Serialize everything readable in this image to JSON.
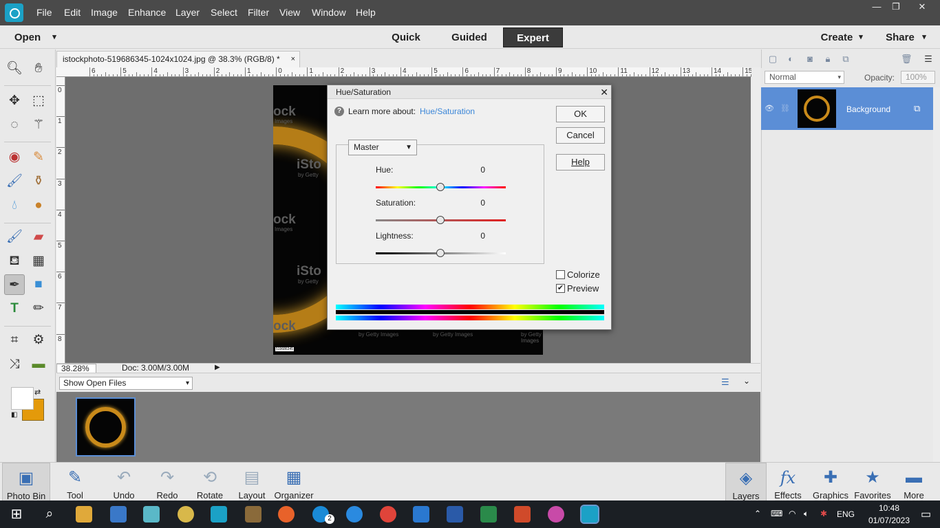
{
  "menubar": {
    "items": [
      "File",
      "Edit",
      "Image",
      "Enhance",
      "Layer",
      "Select",
      "Filter",
      "View",
      "Window",
      "Help"
    ],
    "win_min": "—",
    "win_max": "❐",
    "win_close": "✕"
  },
  "modebar": {
    "open_label": "Open",
    "open_arrow": "▾",
    "modes": [
      "Quick",
      "Guided",
      "Expert"
    ],
    "active_mode": "Expert",
    "create_label": "Create",
    "share_label": "Share",
    "arrow": "▾"
  },
  "document": {
    "tab_title": "istockphoto-519686345-1024x1024.jpg @ 38.3% (RGB/8) *",
    "tab_close": "×",
    "zoom": "38.28%",
    "doc_info": "Doc: 3.00M/3.00M",
    "ruler_top": [
      "6",
      "5",
      "4",
      "3",
      "2",
      "1",
      "0",
      "1",
      "2",
      "3",
      "4",
      "5",
      "6",
      "7",
      "8",
      "9",
      "10",
      "11",
      "12",
      "13",
      "14",
      "15"
    ],
    "ruler_left": [
      "0",
      "1",
      "2",
      "3",
      "4",
      "5",
      "6",
      "7",
      "8"
    ],
    "watermark": [
      "ock",
      "iSto",
      "ock",
      "iSto",
      "ock"
    ],
    "watermark_small": [
      "Images",
      "by Getty",
      "Images",
      "by Getty",
      "by Getty Images",
      "by Getty Images",
      "by Getty Images"
    ],
    "image_id": "519686345"
  },
  "bin": {
    "select_label": "Show Open Files",
    "arrow": "▾"
  },
  "layers_panel": {
    "blend_mode": "Normal",
    "opacity_label": "Opacity:",
    "opacity_value": "100%",
    "layer_name": "Background"
  },
  "actionbar": {
    "left": [
      {
        "label": "Photo Bin",
        "icon": "photo-bin-icon"
      },
      {
        "label": "Tool Options",
        "icon": "tool-options-icon"
      },
      {
        "label": "Undo",
        "icon": "undo-icon"
      },
      {
        "label": "Redo",
        "icon": "redo-icon"
      },
      {
        "label": "Rotate",
        "icon": "rotate-icon"
      },
      {
        "label": "Layout",
        "icon": "layout-icon"
      },
      {
        "label": "Organizer",
        "icon": "organizer-icon"
      }
    ],
    "right": [
      {
        "label": "Layers",
        "icon": "layers-icon"
      },
      {
        "label": "Effects",
        "icon": "effects-icon"
      },
      {
        "label": "Graphics",
        "icon": "graphics-icon"
      },
      {
        "label": "Favorites",
        "icon": "favorites-icon"
      },
      {
        "label": "More",
        "icon": "more-icon"
      }
    ]
  },
  "dialog": {
    "title": "Hue/Saturation",
    "close": "✕",
    "learn_prefix": "Learn more about:",
    "learn_link": "Hue/Saturation",
    "ok": "OK",
    "cancel": "Cancel",
    "help": "Help",
    "channel": "Master",
    "hue_label": "Hue:",
    "hue_value": "0",
    "sat_label": "Saturation:",
    "sat_value": "0",
    "light_label": "Lightness:",
    "light_value": "0",
    "colorize_label": "Colorize",
    "colorize_checked": false,
    "preview_label": "Preview",
    "preview_checked": true
  },
  "taskbar": {
    "lang": "ENG",
    "time": "10:48",
    "date": "01/07/2023",
    "s_badge": "2"
  },
  "colors": {
    "foreground": "#ffffff",
    "background": "#e49a0a",
    "accent": "#5b8ed6",
    "link": "#3b86d8"
  }
}
